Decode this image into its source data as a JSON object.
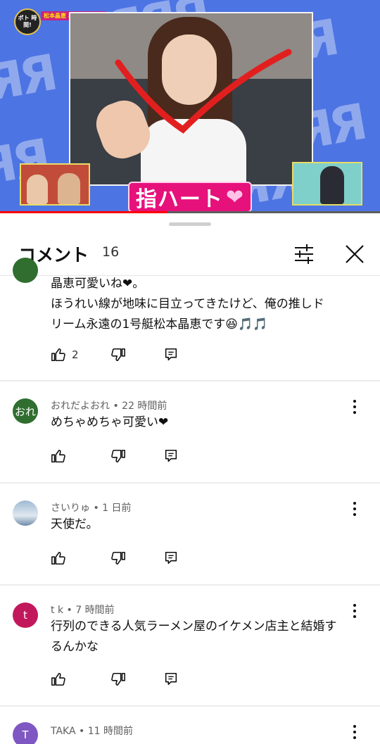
{
  "video": {
    "badge_text": "ポト 時間!",
    "caption": "松本晶恵 おうちの時間!",
    "banner_text": "指ハート",
    "banner_heart": "❤",
    "progress_fraction": 0.44,
    "colors": {
      "background": "#4d74e3",
      "banner": "#e6117b",
      "progress": "#ff0000"
    }
  },
  "sheet": {
    "title": "コメント",
    "count": "16",
    "filter_icon": "tune-icon",
    "close_icon": "close-icon"
  },
  "comments": [
    {
      "author": "",
      "lines": [
        "晶恵可愛いね❤。",
        "ほうれい線が地味に目立ってきたけど、俺の推しド",
        "リーム永遠の1号艇松本晶恵です😆🎵🎵"
      ],
      "likes": "2",
      "avatar_text": "",
      "avatar_color": "#2f6e2f"
    },
    {
      "author": "おれだよおれ • 22 時間前",
      "lines": [
        "めちゃめちゃ可愛い❤"
      ],
      "likes": "",
      "avatar_text": "おれ",
      "avatar_color": "#2f6e2f"
    },
    {
      "author": "さいりゅ • 1 日前",
      "lines": [
        "天使だ。"
      ],
      "likes": "",
      "avatar_text": "",
      "avatar_color": "#7a99b8"
    },
    {
      "author": "t k • 7 時間前",
      "lines": [
        "行列のできる人気ラーメン屋のイケメン店主と結婚す",
        "るんかな"
      ],
      "likes": "",
      "avatar_text": "t",
      "avatar_color": "#c2185b"
    },
    {
      "author": "TAKA • 11 時間前",
      "lines": [],
      "likes": "",
      "avatar_text": "T",
      "avatar_color": "#7e57c2"
    }
  ]
}
